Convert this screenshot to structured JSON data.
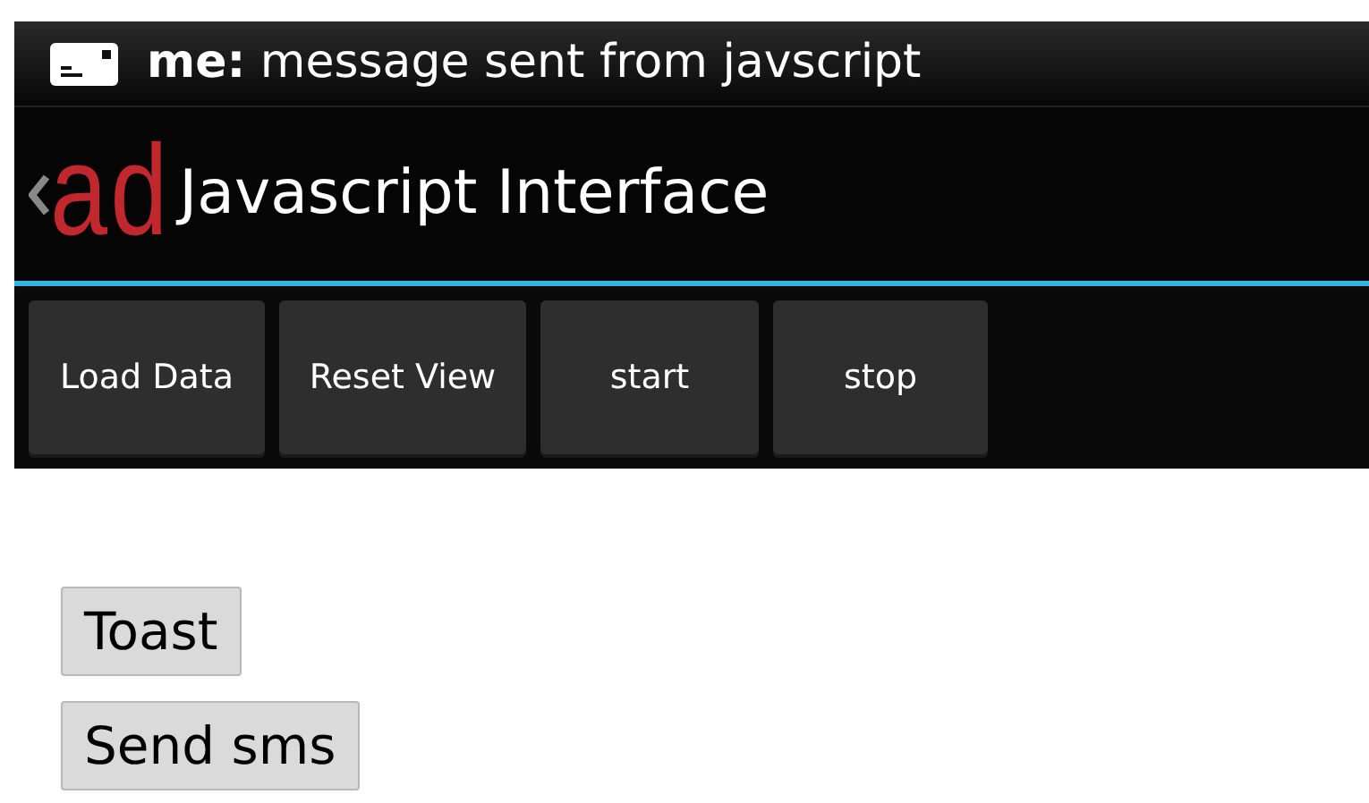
{
  "status_bar": {
    "notification": "**me:** message sent from javscript"
  },
  "action_bar": {
    "logo": "ad",
    "title": "Javascript Interface"
  },
  "toolbar": {
    "buttons": [
      "Load Data",
      "Reset View",
      "start",
      "stop"
    ]
  },
  "web_content": {
    "buttons": [
      "Toast",
      "Send sms"
    ]
  }
}
